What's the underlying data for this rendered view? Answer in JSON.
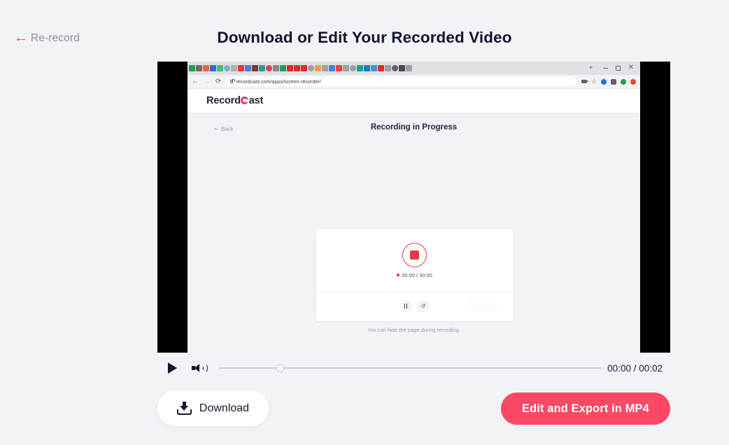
{
  "header": {
    "rerecord_label": "Re-record",
    "rerecord_arrow": "←",
    "title": "Download or Edit Your Recorded Video"
  },
  "video": {
    "browser": {
      "url": "recordcast.com/apps/screen-recorder/",
      "new_tab_glyph": "+",
      "back_glyph": "←",
      "forward_glyph": "→",
      "reload_glyph": "⟳",
      "star_glyph": "☆",
      "puzzle_glyph": "🧩",
      "close_glyph": "✕",
      "favicon_colors": [
        "#1e9e54",
        "#6d6d6d",
        "#e8634a",
        "#2b6fd6",
        "#4cb87a",
        "#8aa8c8",
        "#b0b0b0",
        "#e03a3a",
        "#4a7fd6",
        "#7a3a2a",
        "#2a9d8f",
        "#e8384f",
        "#8a8a8a",
        "#1f9e63",
        "#d93025",
        "#d93025",
        "#d93025",
        "#9aa0a6",
        "#f4a33a",
        "#9aa0a6",
        "#4a7fd6",
        "#ea4335",
        "#9aa0a6",
        "#9aa0a6",
        "#1f9e8a",
        "#2b6fd6",
        "#4a90d6",
        "#d93025",
        "#9aa0a6",
        "#5f6368",
        "#4a4a4a",
        "#9aa0a6"
      ],
      "extension_colors": [
        "#1a73e8",
        "#5f6368",
        "#1f9e4a",
        "#ea4335"
      ]
    },
    "app": {
      "logo_prefix": "Record",
      "logo_suffix": "ast",
      "back_label": "Back",
      "back_arrow": "←",
      "subtitle": "Recording in Progress",
      "timer": "00:00 / 30:00",
      "pause_name": "pause",
      "restart_glyph": "↺",
      "hint": "You can hide the page during recording."
    }
  },
  "player": {
    "play_label": "play",
    "volume_label": "volume",
    "time": "00:00 / 00:02"
  },
  "actions": {
    "download_label": "Download",
    "export_label": "Edit and Export in MP4"
  },
  "colors": {
    "accent_pink": "#fa4865",
    "record_red": "#e8384f",
    "page_bg": "#f2f3f7",
    "text_dark": "#15172e",
    "text_muted": "#8b8e99"
  }
}
